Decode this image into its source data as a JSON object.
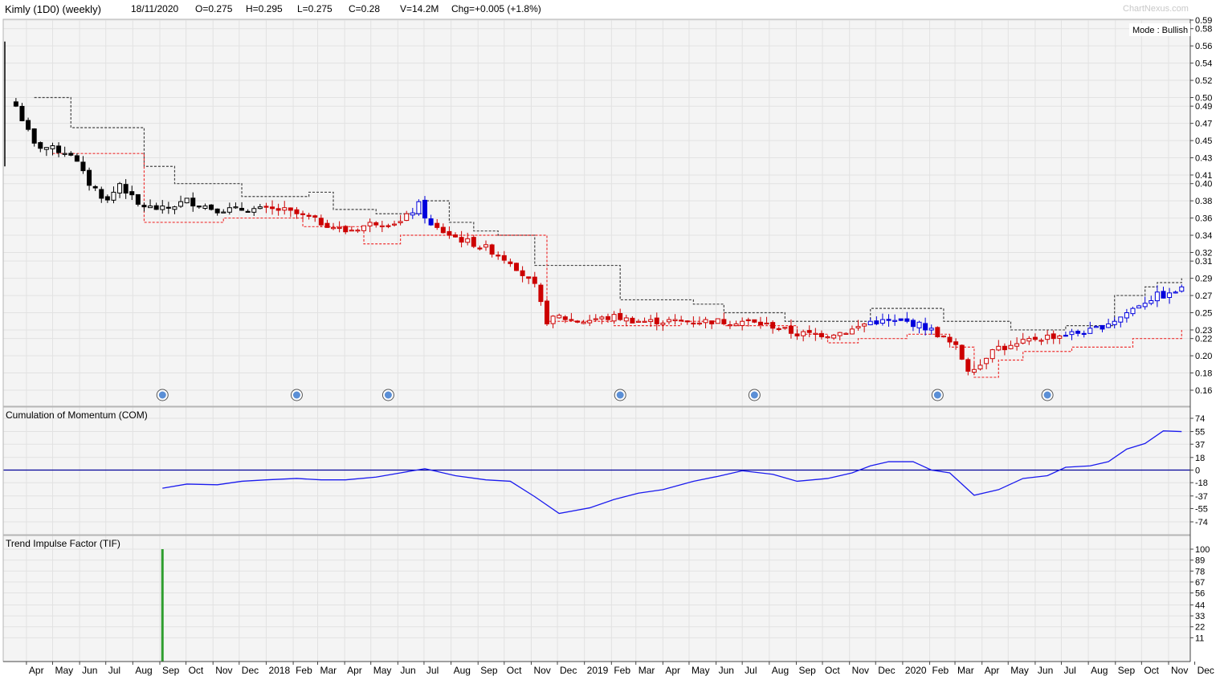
{
  "header": {
    "title": "Kimly (1D0) (weekly)",
    "date": "18/11/2020",
    "open": "O=0.275",
    "high": "H=0.295",
    "low": "L=0.275",
    "close": "C=0.28",
    "volume": "V=14.2M",
    "change": "Chg=+0.005 (+1.8%)",
    "brand": "ChartNexus.com"
  },
  "mode_label": "Mode : Bullish",
  "colors": {
    "bearish": "#cc0000",
    "bearish_upper": "#000000",
    "bullish_blue": "#0000dd",
    "upper_band": "#444444",
    "lower_band": "#ee3333",
    "com_line": "#1a1aee",
    "zero_line": "#000099",
    "tif_bar": "#2e9e2e",
    "alert_icon": "#5b8fd6",
    "grid": "#e2e2e2",
    "panel_bg": "#f4f4f4"
  },
  "x_axis_labels": [
    "Apr",
    "May",
    "Jun",
    "Jul",
    "Aug",
    "Sep",
    "Oct",
    "Nov",
    "Dec",
    "2018",
    "Feb",
    "Mar",
    "Apr",
    "May",
    "Jun",
    "Jul",
    "Aug",
    "Sep",
    "Oct",
    "Nov",
    "Dec",
    "2019",
    "Feb",
    "Mar",
    "Apr",
    "May",
    "Jun",
    "Jul",
    "Aug",
    "Sep",
    "Oct",
    "Nov",
    "Dec",
    "2020",
    "Feb",
    "Mar",
    "Apr",
    "May",
    "Jun",
    "Jul",
    "Aug",
    "Sep",
    "Oct",
    "Nov",
    "Dec"
  ],
  "chart_data": [
    {
      "type": "candlestick",
      "panel": "price",
      "ylim": [
        0.15,
        0.6
      ],
      "y_ticks": [
        "0.59",
        "0.58",
        "0.56",
        "0.54",
        "0.52",
        "0.50",
        "0.49",
        "0.47",
        "0.45",
        "0.43",
        "0.41",
        "0.40",
        "0.38",
        "0.36",
        "0.34",
        "0.32",
        "0.31",
        "0.29",
        "0.27",
        "0.25",
        "0.23",
        "0.22",
        "0.20",
        "0.18",
        "0.16"
      ],
      "alert_markers_approx": [
        "Sep 2017",
        "Feb 2018",
        "May 2018",
        "Feb 2019",
        "Jul 2019",
        "Feb 2020",
        "Jun 2020"
      ],
      "anchors_close": [
        [
          "2017-03-20",
          0.49
        ],
        [
          "2017-04-10",
          0.445
        ],
        [
          "2017-05-01",
          0.44
        ],
        [
          "2017-05-22",
          0.435
        ],
        [
          "2017-06-12",
          0.4
        ],
        [
          "2017-07-03",
          0.38
        ],
        [
          "2017-07-17",
          0.4
        ],
        [
          "2017-08-07",
          0.375
        ],
        [
          "2017-09-04",
          0.37
        ],
        [
          "2017-10-02",
          0.38
        ],
        [
          "2017-11-06",
          0.37
        ],
        [
          "2017-12-11",
          0.37
        ],
        [
          "2018-01-15",
          0.37
        ],
        [
          "2018-02-05",
          0.365
        ],
        [
          "2018-03-05",
          0.355
        ],
        [
          "2018-04-02",
          0.345
        ],
        [
          "2018-05-07",
          0.355
        ],
        [
          "2018-06-04",
          0.355
        ],
        [
          "2018-06-25",
          0.375
        ],
        [
          "2018-07-09",
          0.35
        ],
        [
          "2018-08-13",
          0.335
        ],
        [
          "2018-09-10",
          0.325
        ],
        [
          "2018-10-08",
          0.31
        ],
        [
          "2018-11-05",
          0.28
        ],
        [
          "2018-11-19",
          0.24
        ],
        [
          "2018-12-03",
          0.245
        ],
        [
          "2018-12-24",
          0.24
        ],
        [
          "2019-02-04",
          0.245
        ],
        [
          "2019-03-04",
          0.24
        ],
        [
          "2019-04-01",
          0.24
        ],
        [
          "2019-05-06",
          0.24
        ],
        [
          "2019-06-03",
          0.24
        ],
        [
          "2019-07-01",
          0.24
        ],
        [
          "2019-08-05",
          0.235
        ],
        [
          "2019-09-02",
          0.225
        ],
        [
          "2019-10-07",
          0.225
        ],
        [
          "2019-11-04",
          0.23
        ],
        [
          "2019-11-25",
          0.24
        ],
        [
          "2019-12-16",
          0.24
        ],
        [
          "2020-01-13",
          0.238
        ],
        [
          "2020-02-03",
          0.23
        ],
        [
          "2020-03-02",
          0.21
        ],
        [
          "2020-03-16",
          0.185
        ],
        [
          "2020-03-30",
          0.19
        ],
        [
          "2020-04-13",
          0.21
        ],
        [
          "2020-05-04",
          0.21
        ],
        [
          "2020-06-01",
          0.22
        ],
        [
          "2020-07-06",
          0.225
        ],
        [
          "2020-08-03",
          0.228
        ],
        [
          "2020-08-17",
          0.235
        ],
        [
          "2020-09-07",
          0.245
        ],
        [
          "2020-09-28",
          0.26
        ],
        [
          "2020-10-19",
          0.27
        ],
        [
          "2020-11-02",
          0.27
        ],
        [
          "2020-11-16",
          0.28
        ]
      ],
      "last_bar": {
        "date": "18/11/2020",
        "open": 0.275,
        "high": 0.295,
        "low": 0.275,
        "close": 0.28
      },
      "bands_approx": {
        "upper": [
          [
            "2017-04-10",
            0.5
          ],
          [
            "2017-05-22",
            0.465
          ],
          [
            "2017-08-14",
            0.42
          ],
          [
            "2017-09-18",
            0.4
          ],
          [
            "2017-12-04",
            0.385
          ],
          [
            "2018-02-19",
            0.39
          ],
          [
            "2018-03-19",
            0.37
          ],
          [
            "2018-05-07",
            0.365
          ],
          [
            "2018-07-02",
            0.38
          ],
          [
            "2018-07-30",
            0.355
          ],
          [
            "2018-08-27",
            0.345
          ],
          [
            "2018-09-24",
            0.34
          ],
          [
            "2018-10-22",
            0.34
          ],
          [
            "2018-11-05",
            0.305
          ],
          [
            "2019-02-11",
            0.265
          ],
          [
            "2019-05-06",
            0.26
          ],
          [
            "2019-06-10",
            0.25
          ],
          [
            "2019-08-19",
            0.24
          ],
          [
            "2019-10-14",
            0.24
          ],
          [
            "2019-11-25",
            0.255
          ],
          [
            "2019-12-30",
            0.255
          ],
          [
            "2020-02-17",
            0.24
          ],
          [
            "2020-04-20",
            0.24
          ],
          [
            "2020-05-04",
            0.23
          ],
          [
            "2020-06-01",
            0.23
          ],
          [
            "2020-07-06",
            0.235
          ],
          [
            "2020-08-31",
            0.27
          ],
          [
            "2020-10-05",
            0.28
          ],
          [
            "2020-10-19",
            0.285
          ],
          [
            "2020-11-16",
            0.29
          ]
        ],
        "lower": [
          [
            "2017-05-01",
            0.435
          ],
          [
            "2017-08-14",
            0.355
          ],
          [
            "2017-10-02",
            0.355
          ],
          [
            "2017-11-13",
            0.36
          ],
          [
            "2018-02-12",
            0.35
          ],
          [
            "2018-04-23",
            0.33
          ],
          [
            "2018-06-04",
            0.34
          ],
          [
            "2018-07-02",
            0.34
          ],
          [
            "2018-09-24",
            0.34
          ],
          [
            "2018-11-19",
            0.24
          ],
          [
            "2019-02-04",
            0.235
          ],
          [
            "2019-04-22",
            0.24
          ],
          [
            "2019-06-10",
            0.235
          ],
          [
            "2019-09-02",
            0.225
          ],
          [
            "2019-10-07",
            0.215
          ],
          [
            "2019-11-11",
            0.22
          ],
          [
            "2020-01-06",
            0.225
          ],
          [
            "2020-02-24",
            0.21
          ],
          [
            "2020-03-23",
            0.175
          ],
          [
            "2020-04-20",
            0.195
          ],
          [
            "2020-05-18",
            0.205
          ],
          [
            "2020-07-13",
            0.21
          ],
          [
            "2020-08-24",
            0.21
          ],
          [
            "2020-09-21",
            0.22
          ],
          [
            "2020-11-16",
            0.23
          ]
        ]
      }
    },
    {
      "type": "line",
      "panel": "COM",
      "title": "Cumulation of Momentum (COM)",
      "ylim": [
        -80,
        80
      ],
      "y_ticks": [
        "74",
        "55",
        "37",
        "18",
        "0",
        "-18",
        "-37",
        "-55",
        "-74"
      ],
      "points": [
        [
          "2017-09-04",
          -26
        ],
        [
          "2017-10-02",
          -20
        ],
        [
          "2017-11-06",
          -21
        ],
        [
          "2017-12-04",
          -16
        ],
        [
          "2018-01-01",
          -14
        ],
        [
          "2018-02-05",
          -12
        ],
        [
          "2018-03-05",
          -14
        ],
        [
          "2018-04-02",
          -14
        ],
        [
          "2018-05-07",
          -10
        ],
        [
          "2018-06-04",
          -4
        ],
        [
          "2018-07-02",
          2
        ],
        [
          "2018-08-06",
          -8
        ],
        [
          "2018-09-10",
          -14
        ],
        [
          "2018-10-08",
          -16
        ],
        [
          "2018-11-05",
          -38
        ],
        [
          "2018-12-03",
          -62
        ],
        [
          "2019-01-07",
          -54
        ],
        [
          "2019-02-04",
          -42
        ],
        [
          "2019-03-04",
          -33
        ],
        [
          "2019-04-01",
          -28
        ],
        [
          "2019-05-06",
          -16
        ],
        [
          "2019-06-03",
          -9
        ],
        [
          "2019-07-01",
          -1
        ],
        [
          "2019-08-05",
          -6
        ],
        [
          "2019-09-02",
          -16
        ],
        [
          "2019-10-07",
          -12
        ],
        [
          "2019-11-04",
          -4
        ],
        [
          "2019-11-25",
          6
        ],
        [
          "2019-12-16",
          12
        ],
        [
          "2020-01-13",
          12
        ],
        [
          "2020-02-03",
          0
        ],
        [
          "2020-02-24",
          -4
        ],
        [
          "2020-03-23",
          -36
        ],
        [
          "2020-04-20",
          -28
        ],
        [
          "2020-05-18",
          -12
        ],
        [
          "2020-06-15",
          -8
        ],
        [
          "2020-07-06",
          4
        ],
        [
          "2020-08-03",
          6
        ],
        [
          "2020-08-24",
          12
        ],
        [
          "2020-09-14",
          30
        ],
        [
          "2020-10-05",
          38
        ],
        [
          "2020-10-26",
          56
        ],
        [
          "2020-11-16",
          55
        ]
      ]
    },
    {
      "type": "bar",
      "panel": "TIF",
      "title": "Trend Impulse Factor (TIF)",
      "ylim": [
        0,
        105
      ],
      "y_ticks": [
        "100",
        "89",
        "78",
        "67",
        "56",
        "44",
        "33",
        "22",
        "11"
      ],
      "bars": [
        {
          "x": "2017-09-04",
          "value": 100
        }
      ]
    }
  ]
}
